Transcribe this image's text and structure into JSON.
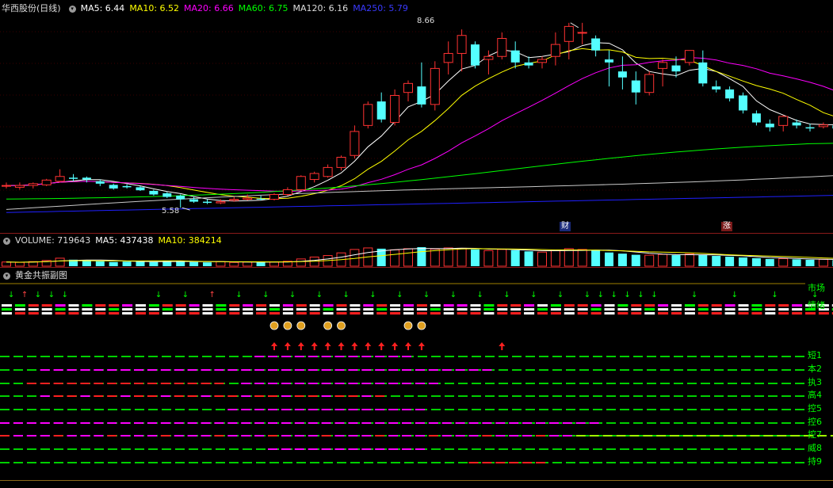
{
  "header": {
    "title": "华西股份(日线)",
    "ma5": "MA5: 6.44",
    "ma10": "MA10: 6.52",
    "ma20": "MA20: 6.66",
    "ma60": "MA60: 6.75",
    "ma120": "MA120: 6.16",
    "ma250": "MA250: 5.79"
  },
  "price_annotations": {
    "high": "8.66",
    "low": "5.58",
    "tag_cai": "财",
    "tag_zhang": "涨"
  },
  "volume_header": {
    "volume": "VOLUME: 719643",
    "ma5": "MA5: 437438",
    "ma10": "MA10: 384214"
  },
  "indicator_header": {
    "title": "黄金共振副图"
  },
  "indicator_labels": {
    "market": "市场",
    "sentiment": "情绪",
    "rows": [
      "短1",
      "本2",
      "执3",
      "高4",
      "控5",
      "控6",
      "控7",
      "威8",
      "持9"
    ]
  },
  "colors": {
    "up": "#ff3232",
    "down": "#54ffff",
    "ma5": "#ffffff",
    "ma10": "#ffff00",
    "ma20": "#ff00ff",
    "ma60": "#00ff00",
    "ma120": "#c8c8c8",
    "ma250": "#2020ff"
  },
  "chart_data": {
    "type": "candlestick",
    "candles": [
      [
        5.95,
        5.95,
        5.9,
        6.0
      ],
      [
        5.92,
        5.95,
        5.88,
        6.0
      ],
      [
        5.95,
        5.98,
        5.9,
        6.0
      ],
      [
        5.96,
        6.04,
        5.94,
        6.06
      ],
      [
        6.02,
        6.1,
        6.0,
        6.22
      ],
      [
        6.08,
        6.06,
        6.02,
        6.14
      ],
      [
        6.08,
        6.05,
        6.0,
        6.1
      ],
      [
        6.02,
        5.98,
        5.94,
        6.05
      ],
      [
        5.96,
        5.9,
        5.88,
        5.98
      ],
      [
        5.94,
        5.92,
        5.9,
        5.97
      ],
      [
        5.92,
        5.87,
        5.86,
        5.94
      ],
      [
        5.86,
        5.8,
        5.78,
        5.88
      ],
      [
        5.82,
        5.76,
        5.74,
        5.84
      ],
      [
        5.78,
        5.72,
        5.58,
        5.8
      ],
      [
        5.72,
        5.68,
        5.66,
        5.76
      ],
      [
        5.68,
        5.66,
        5.64,
        5.72
      ],
      [
        5.66,
        5.68,
        5.64,
        5.72
      ],
      [
        5.7,
        5.72,
        5.68,
        5.76
      ],
      [
        5.72,
        5.74,
        5.7,
        5.8
      ],
      [
        5.73,
        5.72,
        5.7,
        5.78
      ],
      [
        5.72,
        5.8,
        5.7,
        5.82
      ],
      [
        5.8,
        5.88,
        5.78,
        5.92
      ],
      [
        5.88,
        6.1,
        5.86,
        6.12
      ],
      [
        6.05,
        6.15,
        6.0,
        6.18
      ],
      [
        6.1,
        6.25,
        6.08,
        6.3
      ],
      [
        6.25,
        6.42,
        6.2,
        6.45
      ],
      [
        6.45,
        6.85,
        6.4,
        6.95
      ],
      [
        6.95,
        7.3,
        6.9,
        7.35
      ],
      [
        7.35,
        7.05,
        7.0,
        7.5
      ],
      [
        7.0,
        7.45,
        6.95,
        7.55
      ],
      [
        7.5,
        7.65,
        7.35,
        7.7
      ],
      [
        7.6,
        7.3,
        7.25,
        8.0
      ],
      [
        7.3,
        7.9,
        7.2,
        8.02
      ],
      [
        8.0,
        8.15,
        7.8,
        8.35
      ],
      [
        8.15,
        8.45,
        7.85,
        8.55
      ],
      [
        8.3,
        7.95,
        7.9,
        8.35
      ],
      [
        8.05,
        8.1,
        7.8,
        8.2
      ],
      [
        8.1,
        8.4,
        8.05,
        8.5
      ],
      [
        8.2,
        8.0,
        7.9,
        8.35
      ],
      [
        8.0,
        7.95,
        7.9,
        8.1
      ],
      [
        8.0,
        8.05,
        7.9,
        8.1
      ],
      [
        8.1,
        8.3,
        7.95,
        8.5
      ],
      [
        8.35,
        8.6,
        8.05,
        8.66
      ],
      [
        8.5,
        8.5,
        8.3,
        8.66
      ],
      [
        8.4,
        8.2,
        8.1,
        8.45
      ],
      [
        8.05,
        8.0,
        7.6,
        8.2
      ],
      [
        7.85,
        7.75,
        7.55,
        8.1
      ],
      [
        7.7,
        7.5,
        7.3,
        7.85
      ],
      [
        7.5,
        7.8,
        7.45,
        7.85
      ],
      [
        7.9,
        8.0,
        7.6,
        8.05
      ],
      [
        7.95,
        7.85,
        7.75,
        8.1
      ],
      [
        8.0,
        8.2,
        7.95,
        8.2
      ],
      [
        8.0,
        7.65,
        7.6,
        8.2
      ],
      [
        7.6,
        7.55,
        7.5,
        7.7
      ],
      [
        7.55,
        7.4,
        7.35,
        7.6
      ],
      [
        7.45,
        7.2,
        7.15,
        7.5
      ],
      [
        7.15,
        7.0,
        6.95,
        7.2
      ],
      [
        6.98,
        6.92,
        6.85,
        7.05
      ],
      [
        6.95,
        7.1,
        6.85,
        7.12
      ],
      [
        7.0,
        6.95,
        6.9,
        7.05
      ],
      [
        6.92,
        6.9,
        6.85,
        6.98
      ],
      [
        6.93,
        6.96,
        6.9,
        7.0
      ],
      [
        6.95,
        6.9,
        6.85,
        7.02
      ],
      [
        6.92,
        6.9,
        6.85,
        7.0
      ],
      [
        6.88,
        6.86,
        6.84,
        6.95
      ],
      [
        6.86,
        6.8,
        6.76,
        6.9
      ],
      [
        6.78,
        6.72,
        6.68,
        6.82
      ],
      [
        6.72,
        6.6,
        6.58,
        6.75
      ],
      [
        6.62,
        6.66,
        6.58,
        6.68
      ],
      [
        6.7,
        6.95,
        6.66,
        7.02
      ],
      [
        7.05,
        6.75,
        6.7,
        7.06
      ],
      [
        6.8,
        6.75,
        6.7,
        6.85
      ],
      [
        6.72,
        6.6,
        6.35,
        6.75
      ],
      [
        6.55,
        6.6,
        6.5,
        6.7
      ],
      [
        6.6,
        6.62,
        6.4,
        6.72
      ],
      [
        6.62,
        6.8,
        6.6,
        6.92
      ]
    ],
    "volumes": [
      22,
      20,
      24,
      30,
      42,
      34,
      30,
      26,
      22,
      24,
      24,
      22,
      28,
      26,
      22,
      20,
      24,
      20,
      22,
      20,
      22,
      26,
      38,
      48,
      56,
      70,
      88,
      96,
      92,
      86,
      92,
      100,
      90,
      96,
      94,
      88,
      82,
      88,
      84,
      78,
      74,
      82,
      92,
      88,
      86,
      72,
      66,
      60,
      58,
      62,
      58,
      64,
      58,
      54,
      50,
      46,
      42,
      38,
      40,
      36,
      34,
      36,
      32,
      34,
      30,
      28,
      28,
      26,
      30,
      46,
      40,
      34,
      38,
      36,
      40,
      72
    ]
  }
}
